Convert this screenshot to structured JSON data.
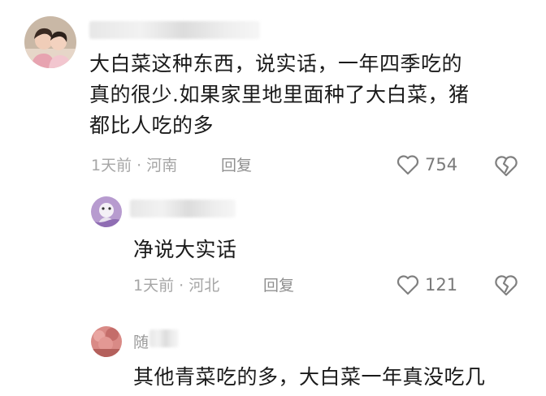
{
  "comments": [
    {
      "text_lines": [
        "大白菜这种东西，说实话，一年四季吃的",
        "真的很少.如果家里地里面种了大白菜，猪",
        "都比人吃的多"
      ],
      "time": "1天前",
      "separator": "·",
      "location": "河南",
      "reply_label": "回复",
      "likes": "754"
    },
    {
      "text": "净说大实话",
      "time": "1天前",
      "separator": "·",
      "location": "河北",
      "reply_label": "回复",
      "likes": "121"
    },
    {
      "username_partial": "随",
      "text": "其他青菜吃的多，大白菜一年真没吃几"
    }
  ],
  "icons": {
    "like": "heart-outline-icon",
    "dislike": "broken-heart-icon"
  },
  "colors": {
    "text": "#1a1a1a",
    "meta": "#a6a6a6",
    "icon": "#808080"
  }
}
